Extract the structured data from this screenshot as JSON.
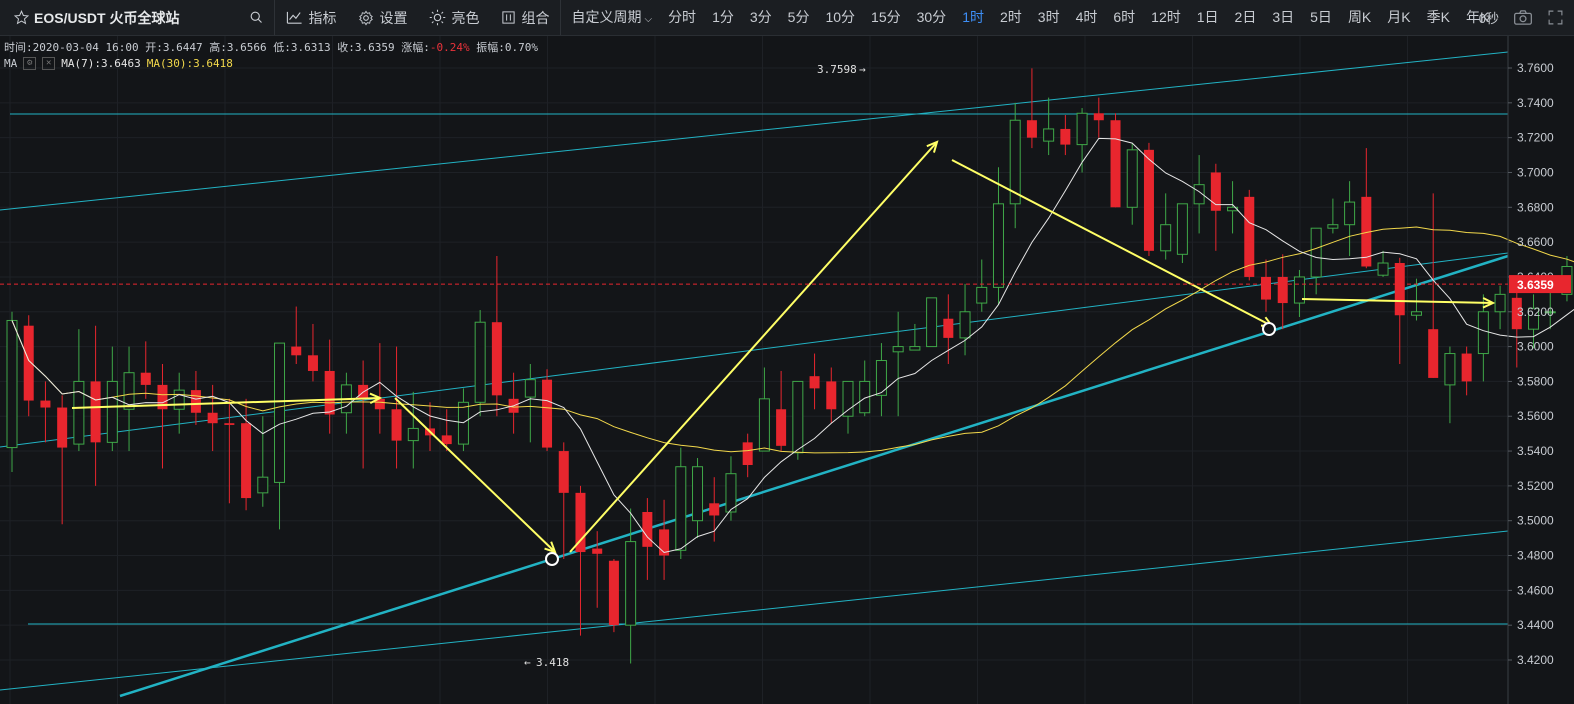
{
  "toolbar": {
    "symbol": "EOS/USDT 火币全球站",
    "indicators_label": "指标",
    "settings_label": "设置",
    "brightness_label": "亮色",
    "combo_label": "组合",
    "custom_period_label": "自定义周期",
    "periods": [
      "分时",
      "1分",
      "3分",
      "5分",
      "10分",
      "15分",
      "30分",
      "1时",
      "2时",
      "3时",
      "4时",
      "6时",
      "12时",
      "1日",
      "2日",
      "3日",
      "5日",
      "周K",
      "月K",
      "季K",
      "年K"
    ],
    "active_period": "1时",
    "countdown": "0秒"
  },
  "info": {
    "time_label": "时间:",
    "time_value": "2020-03-04 16:00",
    "open_label": "开:",
    "open_value": "3.6447",
    "high_label": "高:",
    "high_value": "3.6566",
    "low_label": "低:",
    "low_value": "3.6313",
    "close_label": "收:",
    "close_value": "3.6359",
    "change_label": "涨幅:",
    "change_value": "-0.24%",
    "amplitude_label": "振幅:",
    "amplitude_value": "0.70%"
  },
  "ma": {
    "label": "MA",
    "ma7_label": "MA(7):",
    "ma7_value": "3.6463",
    "ma30_label": "MA(30):",
    "ma30_value": "3.6418"
  },
  "chart_data": {
    "type": "candlestick",
    "ylim": [
      3.405,
      3.77
    ],
    "yticks": [
      "3.7600",
      "3.7400",
      "3.7200",
      "3.7000",
      "3.6800",
      "3.6600",
      "3.6400",
      "3.6200",
      "3.6000",
      "3.5800",
      "3.5600",
      "3.5400",
      "3.5200",
      "3.5000",
      "3.4800",
      "3.4600",
      "3.4400",
      "3.4200"
    ],
    "current_price": "3.6359",
    "max_label": "3.7598",
    "min_label": "3.418",
    "colors": {
      "background": "#131518",
      "up": "#3fa848",
      "down": "#e8262e",
      "ma7": "#e6e6e6",
      "ma30": "#f2d84b",
      "trendline": "#22b3c4",
      "annotation": "#ffff66",
      "price_tag": "#e8262e"
    },
    "candles": [
      {
        "o": 3.542,
        "h": 3.62,
        "l": 3.528,
        "c": 3.615
      },
      {
        "o": 3.612,
        "h": 3.618,
        "l": 3.56,
        "c": 3.569
      },
      {
        "o": 3.569,
        "h": 3.58,
        "l": 3.545,
        "c": 3.565
      },
      {
        "o": 3.565,
        "h": 3.572,
        "l": 3.498,
        "c": 3.542
      },
      {
        "o": 3.544,
        "h": 3.61,
        "l": 3.54,
        "c": 3.58
      },
      {
        "o": 3.58,
        "h": 3.612,
        "l": 3.52,
        "c": 3.545
      },
      {
        "o": 3.545,
        "h": 3.6,
        "l": 3.54,
        "c": 3.58
      },
      {
        "o": 3.564,
        "h": 3.6,
        "l": 3.54,
        "c": 3.585
      },
      {
        "o": 3.585,
        "h": 3.603,
        "l": 3.57,
        "c": 3.578
      },
      {
        "o": 3.578,
        "h": 3.59,
        "l": 3.53,
        "c": 3.564
      },
      {
        "o": 3.564,
        "h": 3.585,
        "l": 3.55,
        "c": 3.575
      },
      {
        "o": 3.575,
        "h": 3.586,
        "l": 3.555,
        "c": 3.562
      },
      {
        "o": 3.562,
        "h": 3.578,
        "l": 3.54,
        "c": 3.556
      },
      {
        "o": 3.556,
        "h": 3.57,
        "l": 3.51,
        "c": 3.555
      },
      {
        "o": 3.556,
        "h": 3.57,
        "l": 3.506,
        "c": 3.513
      },
      {
        "o": 3.516,
        "h": 3.56,
        "l": 3.508,
        "c": 3.525
      },
      {
        "o": 3.522,
        "h": 3.602,
        "l": 3.495,
        "c": 3.602
      },
      {
        "o": 3.6,
        "h": 3.623,
        "l": 3.59,
        "c": 3.595
      },
      {
        "o": 3.595,
        "h": 3.613,
        "l": 3.58,
        "c": 3.586
      },
      {
        "o": 3.586,
        "h": 3.604,
        "l": 3.55,
        "c": 3.561
      },
      {
        "o": 3.562,
        "h": 3.585,
        "l": 3.55,
        "c": 3.578
      },
      {
        "o": 3.578,
        "h": 3.592,
        "l": 3.53,
        "c": 3.57
      },
      {
        "o": 3.57,
        "h": 3.602,
        "l": 3.55,
        "c": 3.564
      },
      {
        "o": 3.564,
        "h": 3.6,
        "l": 3.53,
        "c": 3.546
      },
      {
        "o": 3.546,
        "h": 3.574,
        "l": 3.53,
        "c": 3.553
      },
      {
        "o": 3.553,
        "h": 3.568,
        "l": 3.54,
        "c": 3.549
      },
      {
        "o": 3.549,
        "h": 3.564,
        "l": 3.54,
        "c": 3.544
      },
      {
        "o": 3.544,
        "h": 3.576,
        "l": 3.54,
        "c": 3.568
      },
      {
        "o": 3.568,
        "h": 3.621,
        "l": 3.56,
        "c": 3.614
      },
      {
        "o": 3.614,
        "h": 3.652,
        "l": 3.56,
        "c": 3.572
      },
      {
        "o": 3.57,
        "h": 3.585,
        "l": 3.55,
        "c": 3.562
      },
      {
        "o": 3.571,
        "h": 3.59,
        "l": 3.545,
        "c": 3.581
      },
      {
        "o": 3.581,
        "h": 3.587,
        "l": 3.54,
        "c": 3.542
      },
      {
        "o": 3.54,
        "h": 3.545,
        "l": 3.478,
        "c": 3.516
      },
      {
        "o": 3.516,
        "h": 3.52,
        "l": 3.434,
        "c": 3.482
      },
      {
        "o": 3.484,
        "h": 3.494,
        "l": 3.45,
        "c": 3.481
      },
      {
        "o": 3.477,
        "h": 3.478,
        "l": 3.436,
        "c": 3.44
      },
      {
        "o": 3.44,
        "h": 3.507,
        "l": 3.418,
        "c": 3.488
      },
      {
        "o": 3.505,
        "h": 3.513,
        "l": 3.466,
        "c": 3.485
      },
      {
        "o": 3.495,
        "h": 3.512,
        "l": 3.466,
        "c": 3.48
      },
      {
        "o": 3.483,
        "h": 3.542,
        "l": 3.478,
        "c": 3.531
      },
      {
        "o": 3.5,
        "h": 3.536,
        "l": 3.49,
        "c": 3.531
      },
      {
        "o": 3.51,
        "h": 3.525,
        "l": 3.488,
        "c": 3.503
      },
      {
        "o": 3.505,
        "h": 3.537,
        "l": 3.5,
        "c": 3.527
      },
      {
        "o": 3.545,
        "h": 3.55,
        "l": 3.525,
        "c": 3.532
      },
      {
        "o": 3.54,
        "h": 3.588,
        "l": 3.54,
        "c": 3.57
      },
      {
        "o": 3.564,
        "h": 3.586,
        "l": 3.54,
        "c": 3.543
      },
      {
        "o": 3.539,
        "h": 3.576,
        "l": 3.535,
        "c": 3.58
      },
      {
        "o": 3.583,
        "h": 3.596,
        "l": 3.564,
        "c": 3.576
      },
      {
        "o": 3.58,
        "h": 3.588,
        "l": 3.556,
        "c": 3.564
      },
      {
        "o": 3.56,
        "h": 3.58,
        "l": 3.55,
        "c": 3.58
      },
      {
        "o": 3.562,
        "h": 3.592,
        "l": 3.56,
        "c": 3.58
      },
      {
        "o": 3.572,
        "h": 3.602,
        "l": 3.56,
        "c": 3.592
      },
      {
        "o": 3.597,
        "h": 3.62,
        "l": 3.56,
        "c": 3.6
      },
      {
        "o": 3.598,
        "h": 3.613,
        "l": 3.598,
        "c": 3.6
      },
      {
        "o": 3.6,
        "h": 3.628,
        "l": 3.6,
        "c": 3.628
      },
      {
        "o": 3.616,
        "h": 3.63,
        "l": 3.59,
        "c": 3.605
      },
      {
        "o": 3.605,
        "h": 3.636,
        "l": 3.595,
        "c": 3.62
      },
      {
        "o": 3.625,
        "h": 3.65,
        "l": 3.62,
        "c": 3.634
      },
      {
        "o": 3.634,
        "h": 3.703,
        "l": 3.624,
        "c": 3.682
      },
      {
        "o": 3.682,
        "h": 3.74,
        "l": 3.668,
        "c": 3.73
      },
      {
        "o": 3.73,
        "h": 3.7598,
        "l": 3.714,
        "c": 3.72
      },
      {
        "o": 3.718,
        "h": 3.743,
        "l": 3.71,
        "c": 3.725
      },
      {
        "o": 3.725,
        "h": 3.733,
        "l": 3.71,
        "c": 3.716
      },
      {
        "o": 3.716,
        "h": 3.737,
        "l": 3.7,
        "c": 3.734
      },
      {
        "o": 3.734,
        "h": 3.743,
        "l": 3.72,
        "c": 3.73
      },
      {
        "o": 3.73,
        "h": 3.734,
        "l": 3.68,
        "c": 3.68
      },
      {
        "o": 3.68,
        "h": 3.717,
        "l": 3.67,
        "c": 3.713
      },
      {
        "o": 3.713,
        "h": 3.717,
        "l": 3.652,
        "c": 3.655
      },
      {
        "o": 3.655,
        "h": 3.688,
        "l": 3.65,
        "c": 3.67
      },
      {
        "o": 3.653,
        "h": 3.682,
        "l": 3.648,
        "c": 3.682
      },
      {
        "o": 3.682,
        "h": 3.71,
        "l": 3.665,
        "c": 3.693
      },
      {
        "o": 3.7,
        "h": 3.705,
        "l": 3.655,
        "c": 3.678
      },
      {
        "o": 3.678,
        "h": 3.695,
        "l": 3.665,
        "c": 3.68
      },
      {
        "o": 3.686,
        "h": 3.69,
        "l": 3.638,
        "c": 3.64
      },
      {
        "o": 3.64,
        "h": 3.65,
        "l": 3.62,
        "c": 3.627
      },
      {
        "o": 3.64,
        "h": 3.653,
        "l": 3.61,
        "c": 3.625
      },
      {
        "o": 3.625,
        "h": 3.644,
        "l": 3.617,
        "c": 3.64
      },
      {
        "o": 3.64,
        "h": 3.665,
        "l": 3.63,
        "c": 3.668
      },
      {
        "o": 3.668,
        "h": 3.685,
        "l": 3.665,
        "c": 3.67
      },
      {
        "o": 3.67,
        "h": 3.695,
        "l": 3.652,
        "c": 3.683
      },
      {
        "o": 3.686,
        "h": 3.714,
        "l": 3.645,
        "c": 3.646
      },
      {
        "o": 3.641,
        "h": 3.655,
        "l": 3.64,
        "c": 3.648
      },
      {
        "o": 3.648,
        "h": 3.651,
        "l": 3.59,
        "c": 3.618
      },
      {
        "o": 3.618,
        "h": 3.639,
        "l": 3.615,
        "c": 3.62
      },
      {
        "o": 3.61,
        "h": 3.688,
        "l": 3.582,
        "c": 3.582
      },
      {
        "o": 3.578,
        "h": 3.6,
        "l": 3.556,
        "c": 3.596
      },
      {
        "o": 3.596,
        "h": 3.6,
        "l": 3.572,
        "c": 3.58
      },
      {
        "o": 3.596,
        "h": 3.63,
        "l": 3.58,
        "c": 3.62
      },
      {
        "o": 3.62,
        "h": 3.635,
        "l": 3.61,
        "c": 3.63
      },
      {
        "o": 3.628,
        "h": 3.632,
        "l": 3.588,
        "c": 3.61
      },
      {
        "o": 3.61,
        "h": 3.63,
        "l": 3.599,
        "c": 3.622
      },
      {
        "o": 3.62,
        "h": 3.64,
        "l": 3.61,
        "c": 3.62
      },
      {
        "o": 3.63,
        "h": 3.652,
        "l": 3.626,
        "c": 3.646
      },
      {
        "o": 3.646,
        "h": 3.656,
        "l": 3.62,
        "c": 3.63
      },
      {
        "o": 3.63,
        "h": 3.64,
        "l": 3.596,
        "c": 3.626
      },
      {
        "o": 3.626,
        "h": 3.662,
        "l": 3.62,
        "c": 3.65
      },
      {
        "o": 3.65,
        "h": 3.662,
        "l": 3.64,
        "c": 3.652
      },
      {
        "o": 3.652,
        "h": 3.662,
        "l": 3.642,
        "c": 3.645
      },
      {
        "o": 3.645,
        "h": 3.66,
        "l": 3.63,
        "c": 3.638
      },
      {
        "o": 3.638,
        "h": 3.669,
        "l": 3.63,
        "c": 3.66
      },
      {
        "o": 3.66,
        "h": 3.668,
        "l": 3.645,
        "c": 3.661
      },
      {
        "o": 3.661,
        "h": 3.666,
        "l": 3.635,
        "c": 3.651
      },
      {
        "o": 3.651,
        "h": 3.66,
        "l": 3.645,
        "c": 3.645
      },
      {
        "o": 3.653,
        "h": 3.659,
        "l": 3.615,
        "c": 3.629
      },
      {
        "o": 3.629,
        "h": 3.647,
        "l": 3.625,
        "c": 3.64
      },
      {
        "o": 3.6447,
        "h": 3.6566,
        "l": 3.6313,
        "c": 3.6359
      }
    ]
  }
}
